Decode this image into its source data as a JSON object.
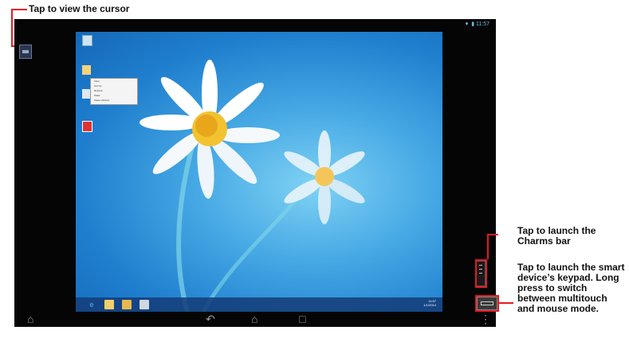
{
  "annotations": {
    "cursor": "Tap to view the cursor",
    "charms": "Tap to launch the Charms bar",
    "keypad": "Tap to launch the smart device’s keypad. Long press to switch between multitouch and mouse mode."
  },
  "status_bar": {
    "time": "11:57",
    "icons": [
      "wifi-icon",
      "battery-icon"
    ]
  },
  "desktop": {
    "icons": [
      {
        "name": "computer-icon"
      },
      {
        "name": "folder-icon"
      },
      {
        "name": "recycle-bin-icon"
      },
      {
        "name": "app-icon"
      }
    ],
    "context_menu_items": [
      "View",
      "Sort by",
      "Refresh",
      "Paste",
      "Paste shortcut",
      "New"
    ],
    "taskbar": {
      "pinned": [
        "internet-explorer-icon",
        "file-explorer-icon",
        "folder-icon",
        "store-icon"
      ],
      "tray_time": "11:57",
      "tray_date": "1/1/2014"
    }
  },
  "colors": {
    "annotation_red": "#e31b23",
    "desktop_blue": "#1f7fce",
    "tablet_black": "#050505"
  },
  "nav_icons": [
    "home-shape-icon",
    "back-icon",
    "home-icon",
    "recents-icon",
    "menu-icon"
  ]
}
